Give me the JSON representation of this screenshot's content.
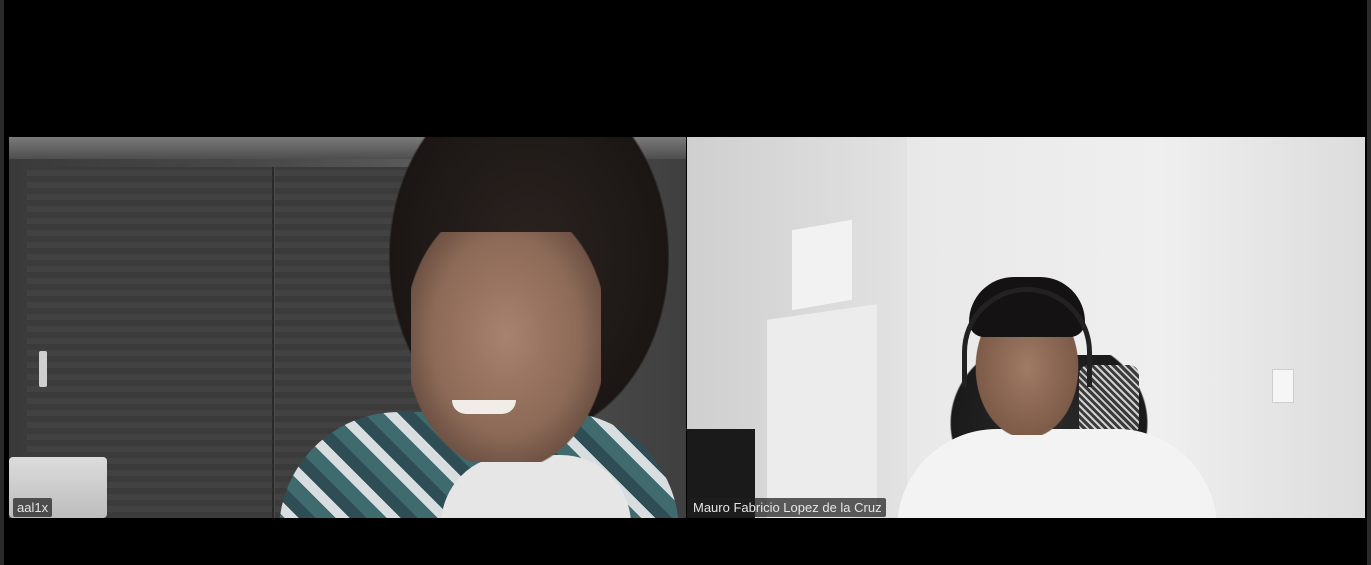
{
  "meeting": {
    "participants": [
      {
        "display_name": "aal1x"
      },
      {
        "display_name": "Mauro Fabricio Lopez de la Cruz"
      }
    ]
  }
}
